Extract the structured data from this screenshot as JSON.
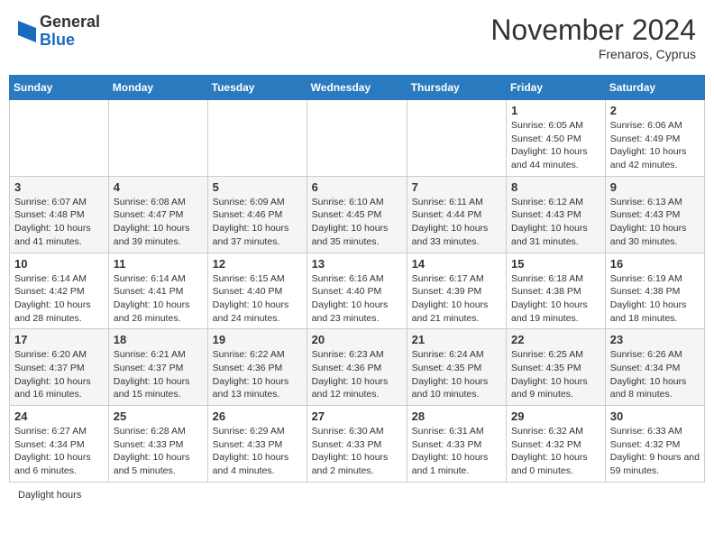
{
  "header": {
    "logo_general": "General",
    "logo_blue": "Blue",
    "month_title": "November 2024",
    "location": "Frenaros, Cyprus"
  },
  "weekdays": [
    "Sunday",
    "Monday",
    "Tuesday",
    "Wednesday",
    "Thursday",
    "Friday",
    "Saturday"
  ],
  "footer": {
    "daylight_hours": "Daylight hours"
  },
  "weeks": [
    [
      {
        "day": "",
        "info": ""
      },
      {
        "day": "",
        "info": ""
      },
      {
        "day": "",
        "info": ""
      },
      {
        "day": "",
        "info": ""
      },
      {
        "day": "",
        "info": ""
      },
      {
        "day": "1",
        "info": "Sunrise: 6:05 AM\nSunset: 4:50 PM\nDaylight: 10 hours and 44 minutes."
      },
      {
        "day": "2",
        "info": "Sunrise: 6:06 AM\nSunset: 4:49 PM\nDaylight: 10 hours and 42 minutes."
      }
    ],
    [
      {
        "day": "3",
        "info": "Sunrise: 6:07 AM\nSunset: 4:48 PM\nDaylight: 10 hours and 41 minutes."
      },
      {
        "day": "4",
        "info": "Sunrise: 6:08 AM\nSunset: 4:47 PM\nDaylight: 10 hours and 39 minutes."
      },
      {
        "day": "5",
        "info": "Sunrise: 6:09 AM\nSunset: 4:46 PM\nDaylight: 10 hours and 37 minutes."
      },
      {
        "day": "6",
        "info": "Sunrise: 6:10 AM\nSunset: 4:45 PM\nDaylight: 10 hours and 35 minutes."
      },
      {
        "day": "7",
        "info": "Sunrise: 6:11 AM\nSunset: 4:44 PM\nDaylight: 10 hours and 33 minutes."
      },
      {
        "day": "8",
        "info": "Sunrise: 6:12 AM\nSunset: 4:43 PM\nDaylight: 10 hours and 31 minutes."
      },
      {
        "day": "9",
        "info": "Sunrise: 6:13 AM\nSunset: 4:43 PM\nDaylight: 10 hours and 30 minutes."
      }
    ],
    [
      {
        "day": "10",
        "info": "Sunrise: 6:14 AM\nSunset: 4:42 PM\nDaylight: 10 hours and 28 minutes."
      },
      {
        "day": "11",
        "info": "Sunrise: 6:14 AM\nSunset: 4:41 PM\nDaylight: 10 hours and 26 minutes."
      },
      {
        "day": "12",
        "info": "Sunrise: 6:15 AM\nSunset: 4:40 PM\nDaylight: 10 hours and 24 minutes."
      },
      {
        "day": "13",
        "info": "Sunrise: 6:16 AM\nSunset: 4:40 PM\nDaylight: 10 hours and 23 minutes."
      },
      {
        "day": "14",
        "info": "Sunrise: 6:17 AM\nSunset: 4:39 PM\nDaylight: 10 hours and 21 minutes."
      },
      {
        "day": "15",
        "info": "Sunrise: 6:18 AM\nSunset: 4:38 PM\nDaylight: 10 hours and 19 minutes."
      },
      {
        "day": "16",
        "info": "Sunrise: 6:19 AM\nSunset: 4:38 PM\nDaylight: 10 hours and 18 minutes."
      }
    ],
    [
      {
        "day": "17",
        "info": "Sunrise: 6:20 AM\nSunset: 4:37 PM\nDaylight: 10 hours and 16 minutes."
      },
      {
        "day": "18",
        "info": "Sunrise: 6:21 AM\nSunset: 4:37 PM\nDaylight: 10 hours and 15 minutes."
      },
      {
        "day": "19",
        "info": "Sunrise: 6:22 AM\nSunset: 4:36 PM\nDaylight: 10 hours and 13 minutes."
      },
      {
        "day": "20",
        "info": "Sunrise: 6:23 AM\nSunset: 4:36 PM\nDaylight: 10 hours and 12 minutes."
      },
      {
        "day": "21",
        "info": "Sunrise: 6:24 AM\nSunset: 4:35 PM\nDaylight: 10 hours and 10 minutes."
      },
      {
        "day": "22",
        "info": "Sunrise: 6:25 AM\nSunset: 4:35 PM\nDaylight: 10 hours and 9 minutes."
      },
      {
        "day": "23",
        "info": "Sunrise: 6:26 AM\nSunset: 4:34 PM\nDaylight: 10 hours and 8 minutes."
      }
    ],
    [
      {
        "day": "24",
        "info": "Sunrise: 6:27 AM\nSunset: 4:34 PM\nDaylight: 10 hours and 6 minutes."
      },
      {
        "day": "25",
        "info": "Sunrise: 6:28 AM\nSunset: 4:33 PM\nDaylight: 10 hours and 5 minutes."
      },
      {
        "day": "26",
        "info": "Sunrise: 6:29 AM\nSunset: 4:33 PM\nDaylight: 10 hours and 4 minutes."
      },
      {
        "day": "27",
        "info": "Sunrise: 6:30 AM\nSunset: 4:33 PM\nDaylight: 10 hours and 2 minutes."
      },
      {
        "day": "28",
        "info": "Sunrise: 6:31 AM\nSunset: 4:33 PM\nDaylight: 10 hours and 1 minute."
      },
      {
        "day": "29",
        "info": "Sunrise: 6:32 AM\nSunset: 4:32 PM\nDaylight: 10 hours and 0 minutes."
      },
      {
        "day": "30",
        "info": "Sunrise: 6:33 AM\nSunset: 4:32 PM\nDaylight: 9 hours and 59 minutes."
      }
    ]
  ]
}
